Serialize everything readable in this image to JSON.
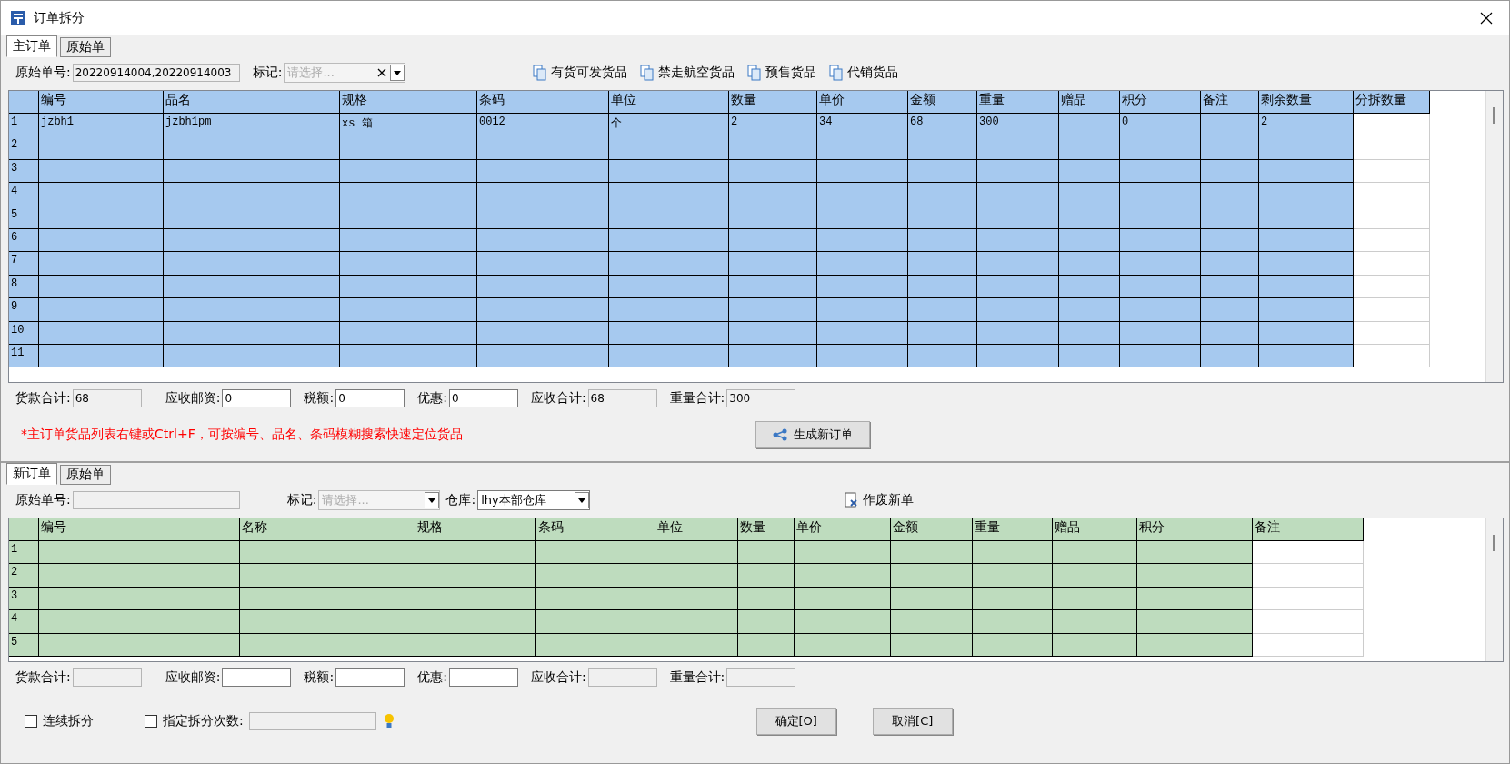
{
  "window": {
    "title": "订单拆分"
  },
  "main_section": {
    "tabs": [
      {
        "label": "主订单",
        "selected": true
      },
      {
        "label": "原始单",
        "selected": false
      }
    ],
    "order_no": {
      "label": "原始单号:",
      "value": "20220914004,20220914003"
    },
    "tag": {
      "label": "标记:",
      "placeholder": "请选择...",
      "clearable": true
    },
    "filters": [
      {
        "label": "有货可发货品"
      },
      {
        "label": "禁走航空货品"
      },
      {
        "label": "预售货品"
      },
      {
        "label": "代销货品"
      }
    ],
    "grid": {
      "columns": [
        {
          "editable": false
        },
        {
          "label": "编号",
          "editable": false
        },
        {
          "label": "品名",
          "editable": false
        },
        {
          "label": "规格",
          "editable": false
        },
        {
          "label": "条码",
          "editable": false
        },
        {
          "label": "单位",
          "editable": false
        },
        {
          "label": "数量",
          "editable": false
        },
        {
          "label": "单价",
          "editable": false
        },
        {
          "label": "金额",
          "editable": false
        },
        {
          "label": "重量",
          "editable": false
        },
        {
          "label": "赠品",
          "editable": false
        },
        {
          "label": "积分",
          "editable": false
        },
        {
          "label": "备注",
          "editable": false
        },
        {
          "label": "剩余数量",
          "editable": false
        },
        {
          "label": "分拆数量",
          "editable": true
        }
      ],
      "rows": [
        {
          "cells": [
            "1",
            "jzbh1",
            "jzbh1pm",
            "xs 箱",
            "0012",
            "个",
            "2",
            "34",
            "68",
            "300",
            "",
            "0",
            "",
            "2",
            ""
          ]
        },
        {
          "cells": [
            "2"
          ]
        },
        {
          "cells": [
            "3"
          ]
        },
        {
          "cells": [
            "4"
          ]
        },
        {
          "cells": [
            "5"
          ]
        },
        {
          "cells": [
            "6"
          ]
        },
        {
          "cells": [
            "7"
          ]
        },
        {
          "cells": [
            "8"
          ]
        },
        {
          "cells": [
            "9"
          ]
        },
        {
          "cells": [
            "10"
          ]
        },
        {
          "cells": [
            "11"
          ]
        }
      ]
    },
    "totals": [
      {
        "label": "货款合计:",
        "value": "68",
        "readonly": true
      },
      {
        "label": "应收邮资:",
        "value": "0",
        "readonly": false
      },
      {
        "label": "税额:",
        "value": "0",
        "readonly": false
      },
      {
        "label": "优惠:",
        "value": "0",
        "readonly": false
      },
      {
        "label": "应收合计:",
        "value": "68",
        "readonly": true
      },
      {
        "label": "重量合计:",
        "value": "300",
        "readonly": true
      }
    ],
    "hint": "*主订单货品列表右键或Ctrl+F，可按编号、品名、条码模糊搜索快速定位货品",
    "generate_button": "生成新订单"
  },
  "new_section": {
    "tabs": [
      {
        "label": "新订单",
        "selected": true
      },
      {
        "label": "原始单",
        "selected": false
      }
    ],
    "order_no": {
      "label": "原始单号:"
    },
    "tag": {
      "label": "标记:",
      "placeholder": "请选择...",
      "clearable": false
    },
    "warehouse": {
      "label": "仓库:",
      "value": "lhy本部仓库"
    },
    "discard_button": "作废新单",
    "grid": {
      "columns": [
        {
          "editable": false
        },
        {
          "label": "编号",
          "editable": false
        },
        {
          "label": "名称",
          "editable": false
        },
        {
          "label": "规格",
          "editable": false
        },
        {
          "label": "条码",
          "editable": false
        },
        {
          "label": "单位",
          "editable": false
        },
        {
          "label": "数量",
          "editable": false
        },
        {
          "label": "单价",
          "editable": false
        },
        {
          "label": "金额",
          "editable": false
        },
        {
          "label": "重量",
          "editable": false
        },
        {
          "label": "赠品",
          "editable": false
        },
        {
          "label": "积分",
          "editable": false
        },
        {
          "label": "备注",
          "editable": true
        }
      ],
      "rows": [
        {
          "cells": [
            "1"
          ]
        },
        {
          "cells": [
            "2"
          ]
        },
        {
          "cells": [
            "3"
          ]
        },
        {
          "cells": [
            "4"
          ]
        },
        {
          "cells": [
            "5"
          ]
        }
      ]
    },
    "totals": [
      {
        "label": "货款合计:",
        "readonly": true
      },
      {
        "label": "应收邮资:",
        "readonly": false
      },
      {
        "label": "税额:",
        "readonly": false
      },
      {
        "label": "优惠:",
        "readonly": false
      },
      {
        "label": "应收合计:",
        "readonly": true
      },
      {
        "label": "重量合计:",
        "readonly": true
      }
    ]
  },
  "options": [
    {
      "label": "连续拆分",
      "checked": false
    },
    {
      "label": "指定拆分次数:",
      "checked": false
    }
  ],
  "buttons": [
    {
      "label": "确定[O]"
    },
    {
      "label": "取消[C]"
    }
  ]
}
